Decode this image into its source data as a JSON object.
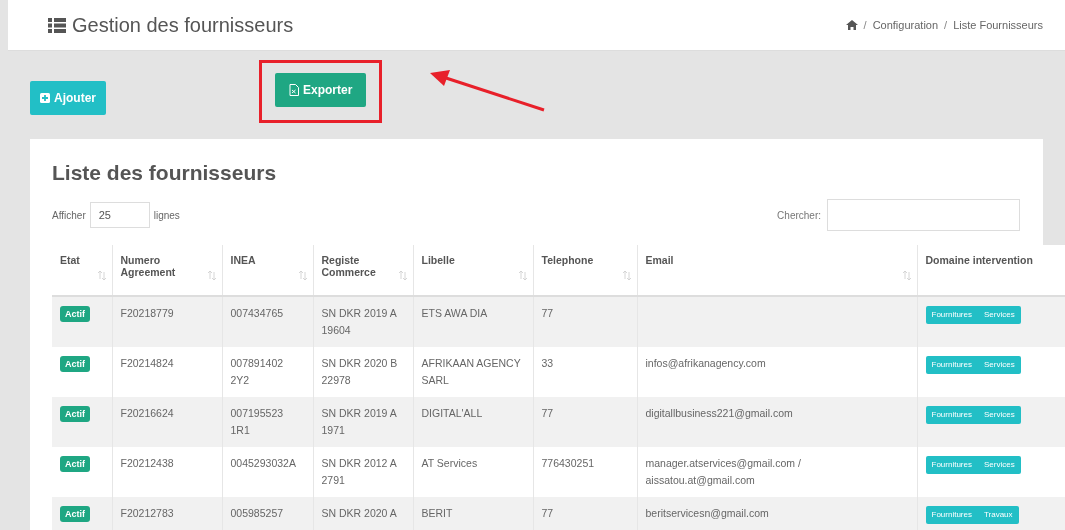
{
  "header": {
    "title": "Gestion des fournisseurs",
    "breadcrumb": {
      "separator": "/",
      "items": [
        "Configuration",
        "Liste Fournisseurs"
      ]
    }
  },
  "toolbar": {
    "buttons": [
      {
        "label": "Ajouter",
        "kind": "add",
        "highlighted": false
      },
      {
        "label": "Exporter",
        "kind": "export",
        "highlighted": true
      }
    ]
  },
  "card": {
    "title": "Liste des fournisseurs",
    "length": {
      "prefix": "Afficher",
      "value": "25",
      "suffix": "lignes"
    },
    "search": {
      "label": "Chercher:"
    },
    "table": {
      "columns": [
        {
          "label": "Etat",
          "sortable": true
        },
        {
          "label": "Numero Agreement",
          "sortable": true
        },
        {
          "label": "INEA",
          "sortable": true
        },
        {
          "label": "Registe Commerce",
          "sortable": true
        },
        {
          "label": "Libelle",
          "sortable": true
        },
        {
          "label": "Telephone",
          "sortable": true
        },
        {
          "label": "Email",
          "sortable": true
        },
        {
          "label": "Domaine intervention",
          "sortable": false
        }
      ],
      "rows": [
        {
          "cells": [
            "Actif",
            "F20218779",
            "007434765",
            "SN DKR 2019 A 19604",
            "ETS AWA DIA",
            "77",
            ""
          ],
          "domaines": [
            "Fournitures",
            "Services"
          ]
        },
        {
          "cells": [
            "Actif",
            "F20214824",
            "007891402 2Y2",
            "SN DKR 2020 B 22978",
            "AFRIKAAN AGENCY SARL",
            "33",
            "infos@afrikanagency.com"
          ],
          "domaines": [
            "Fournitures",
            "Services"
          ]
        },
        {
          "cells": [
            "Actif",
            "F20216624",
            "007195523 1R1",
            "SN DKR 2019 A 1971",
            "DIGITAL'ALL",
            "77",
            "digitallbusiness221@gmail.com"
          ],
          "domaines": [
            "Fournitures",
            "Services"
          ]
        },
        {
          "cells": [
            "Actif",
            "F20212438",
            "0045293032A",
            "SN DKR 2012 A 2791",
            "AT Services",
            "776430251",
            "manager.atservices@gmail.com / aissatou.at@gmail.com"
          ],
          "domaines": [
            "Fournitures",
            "Services"
          ]
        },
        {
          "cells": [
            "Actif",
            "F20212783",
            "005985257",
            "SN DKR 2020 A",
            "BERIT",
            "77",
            "beritservicesn@gmail.com"
          ],
          "domaines": [
            "Fournitures",
            "Travaux"
          ]
        }
      ]
    }
  }
}
